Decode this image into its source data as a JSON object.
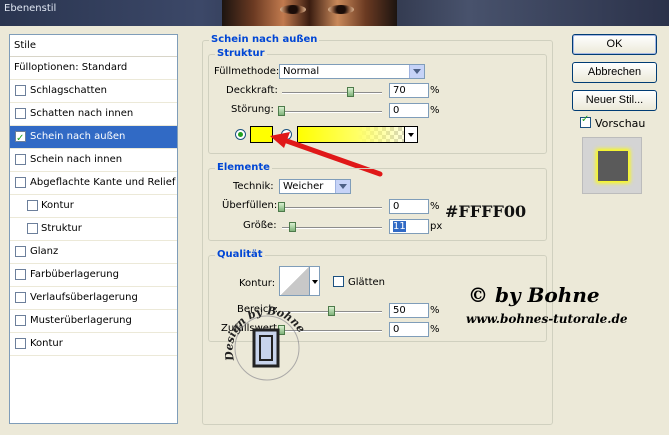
{
  "window": {
    "title": "Ebenenstil"
  },
  "stylelist": {
    "header": "Stile",
    "items": [
      {
        "label": "Fülloptionen: Standard",
        "checkbox": false,
        "checked": false,
        "sub": false,
        "selected": false
      },
      {
        "label": "Schlagschatten",
        "checkbox": true,
        "checked": false,
        "sub": false,
        "selected": false
      },
      {
        "label": "Schatten nach innen",
        "checkbox": true,
        "checked": false,
        "sub": false,
        "selected": false
      },
      {
        "label": "Schein nach außen",
        "checkbox": true,
        "checked": true,
        "sub": false,
        "selected": true
      },
      {
        "label": "Schein nach innen",
        "checkbox": true,
        "checked": false,
        "sub": false,
        "selected": false
      },
      {
        "label": "Abgeflachte Kante und Relief",
        "checkbox": true,
        "checked": false,
        "sub": false,
        "selected": false
      },
      {
        "label": "Kontur",
        "checkbox": true,
        "checked": false,
        "sub": true,
        "selected": false
      },
      {
        "label": "Struktur",
        "checkbox": true,
        "checked": false,
        "sub": true,
        "selected": false
      },
      {
        "label": "Glanz",
        "checkbox": true,
        "checked": false,
        "sub": false,
        "selected": false
      },
      {
        "label": "Farbüberlagerung",
        "checkbox": true,
        "checked": false,
        "sub": false,
        "selected": false
      },
      {
        "label": "Verlaufsüberlagerung",
        "checkbox": true,
        "checked": false,
        "sub": false,
        "selected": false
      },
      {
        "label": "Musterüberlagerung",
        "checkbox": true,
        "checked": false,
        "sub": false,
        "selected": false
      },
      {
        "label": "Kontur",
        "checkbox": true,
        "checked": false,
        "sub": false,
        "selected": false
      }
    ]
  },
  "panel": {
    "title": "Schein nach außen",
    "structure": {
      "legend": "Struktur",
      "blend_label": "Füllmethode:",
      "blend_value": "Normal",
      "opacity_label": "Deckkraft:",
      "opacity_value": "70",
      "opacity_unit": "%",
      "noise_label": "Störung:",
      "noise_value": "0",
      "noise_unit": "%"
    },
    "elements": {
      "legend": "Elemente",
      "technique_label": "Technik:",
      "technique_value": "Weicher",
      "spread_label": "Überfüllen:",
      "spread_value": "0",
      "spread_unit": "%",
      "size_label": "Größe:",
      "size_value": "11",
      "size_unit": "px"
    },
    "quality": {
      "legend": "Qualität",
      "contour_label": "Kontur:",
      "antialias_label": "Glätten",
      "range_label": "Bereich:",
      "range_value": "50",
      "range_unit": "%",
      "jitter_label": "Zufallswert:",
      "jitter_value": "0",
      "jitter_unit": "%"
    }
  },
  "buttons": {
    "ok": "OK",
    "cancel": "Abbrechen",
    "new_style": "Neuer Stil...",
    "preview": "Vorschau"
  },
  "annotation": {
    "color_code": "#FFFF00",
    "author": "© by Bohne",
    "website": "www.bohnes-tutorale.de",
    "watermark": "Design by Bohne"
  },
  "colors": {
    "glow": "#ffff00",
    "arrow": "#e01818",
    "selection": "#316ac5",
    "legend": "#0046d5"
  }
}
